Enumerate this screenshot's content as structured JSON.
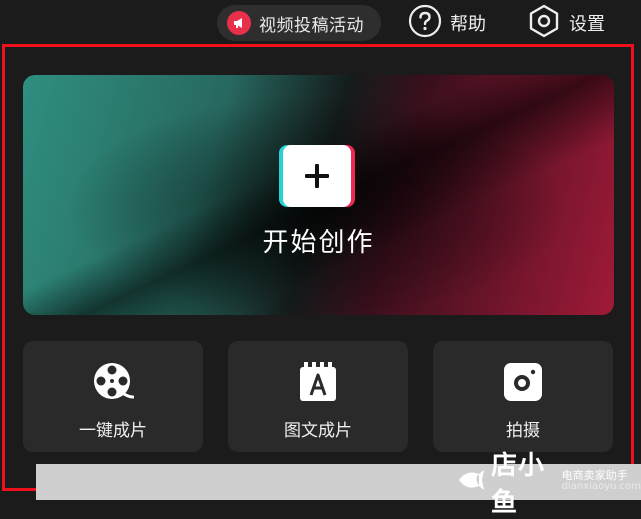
{
  "topbar": {
    "activity_label": "视频投稿活动",
    "help_label": "帮助",
    "settings_label": "设置"
  },
  "hero": {
    "create_label": "开始创作"
  },
  "tools": [
    {
      "label": "一键成片",
      "icon": "film-reel-icon"
    },
    {
      "label": "图文成片",
      "icon": "text-card-icon"
    },
    {
      "label": "拍摄",
      "icon": "camera-icon"
    }
  ],
  "watermark": {
    "brand": "店小鱼",
    "tagline": "电商卖家助手",
    "domain": "dianxiaoyu.com"
  },
  "colors": {
    "highlight_border": "#f0101c",
    "accent_red": "#e8304a",
    "accent_cyan": "#27d2d6",
    "hero_teal": "#2f8f80",
    "hero_crimson": "#a01a38"
  }
}
